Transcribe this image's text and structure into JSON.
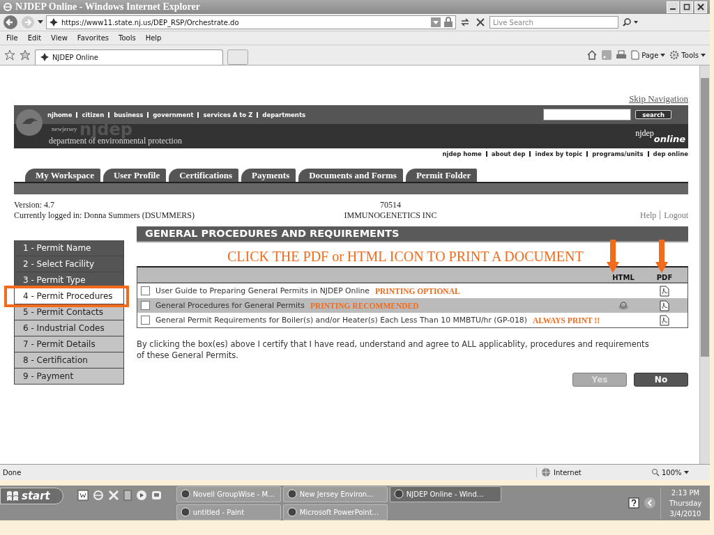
{
  "window": {
    "title": "NJDEP Online - Windows Internet Explorer"
  },
  "address_bar": {
    "url": "https://www11.state.nj.us/DEP_RSP/Orchestrate.do",
    "search_placeholder": "Live Search"
  },
  "menu": [
    "File",
    "Edit",
    "View",
    "Favorites",
    "Tools",
    "Help"
  ],
  "browser_tab": {
    "label": "NJDEP Online"
  },
  "command_bar": [
    "Page",
    "Tools"
  ],
  "page": {
    "skip_link": "Skip Navigation",
    "top_nav": [
      "njhome",
      "citizen",
      "business",
      "government",
      "services A to Z",
      "departments"
    ],
    "search_button": "search",
    "logo": {
      "state": "newjersey",
      "name": "njdep",
      "subtitle": "department of environmental protection",
      "brand": "njdep",
      "brand_suffix": "online"
    },
    "sub_nav": [
      "njdep home",
      "about dep",
      "index by topic",
      "programs/units",
      "dep online"
    ],
    "tabs": [
      {
        "label": "My Workspace",
        "selected": false
      },
      {
        "label": "User Profile",
        "selected": false
      },
      {
        "label": "Certifications",
        "selected": false
      },
      {
        "label": "Payments",
        "selected": false
      },
      {
        "label": "Documents and Forms",
        "selected": false
      },
      {
        "label": "Permit Folder",
        "selected": false
      }
    ],
    "version": "Version: 4.7",
    "logged_in": "Currently logged in: Donna Summers (DSUMMERS)",
    "account_number": "70514",
    "company": "IMMUNOGENETICS INC",
    "help": "Help",
    "logout": "Logout",
    "steps": [
      {
        "label": "1 - Permit Name",
        "done": true,
        "selected": false
      },
      {
        "label": "2 - Select Facility",
        "done": true,
        "selected": false
      },
      {
        "label": "3 - Permit Type",
        "done": true,
        "selected": false
      },
      {
        "label": "4 - Permit Procedures",
        "done": false,
        "selected": true
      },
      {
        "label": "5 - Permit Contacts",
        "done": false,
        "selected": false
      },
      {
        "label": "6 - Industrial Codes",
        "done": false,
        "selected": false
      },
      {
        "label": "7 - Permit Details",
        "done": false,
        "selected": false
      },
      {
        "label": "8 - Certification",
        "done": false,
        "selected": false
      },
      {
        "label": "9 - Payment",
        "done": false,
        "selected": false
      }
    ],
    "heading": "GENERAL PROCEDURES AND REQUIREMENTS",
    "instruction": "CLICK THE PDF or HTML ICON TO PRINT A DOCUMENT",
    "columns": [
      "HTML",
      "PDF"
    ],
    "documents": [
      {
        "title": "User Guide to Preparing General Permits in NJDEP Online",
        "note": "PRINTING OPTIONAL",
        "checked": false,
        "has_html": false,
        "has_pdf": true
      },
      {
        "title": "General Procedures for General Permits",
        "note": "PRINTING  RECOMMENDED",
        "checked": false,
        "has_html": true,
        "has_pdf": true
      },
      {
        "title": "General Permit Requirements for Boiler(s) and/or Heater(s) Each Less Than 10 MMBTU/hr (GP-018)",
        "note": "ALWAYS PRINT !!",
        "checked": false,
        "has_html": false,
        "has_pdf": true
      }
    ],
    "certification": "By clicking the box(es) above I certify that I have read, understand and agree to ALL applicablity, procedures and requirements of these General Permits.",
    "buttons": [
      {
        "label": "Yes",
        "disabled": true
      },
      {
        "label": "No",
        "disabled": false
      }
    ]
  },
  "status_bar": {
    "text": "Done",
    "zone": "Internet",
    "zoom": "100%"
  },
  "taskbar": {
    "start": "start",
    "tasks": [
      {
        "label": "Novell GroupWise - M...",
        "selected": false
      },
      {
        "label": "New Jersey Environ...",
        "selected": false
      },
      {
        "label": "NJDEP Online - Wind...",
        "selected": true
      },
      {
        "label": "untitled - Paint",
        "selected": false
      },
      {
        "label": "Microsoft PowerPoint...",
        "selected": false
      }
    ],
    "time": "2:13 PM",
    "day": "Thursday",
    "date": "3/4/2010"
  }
}
